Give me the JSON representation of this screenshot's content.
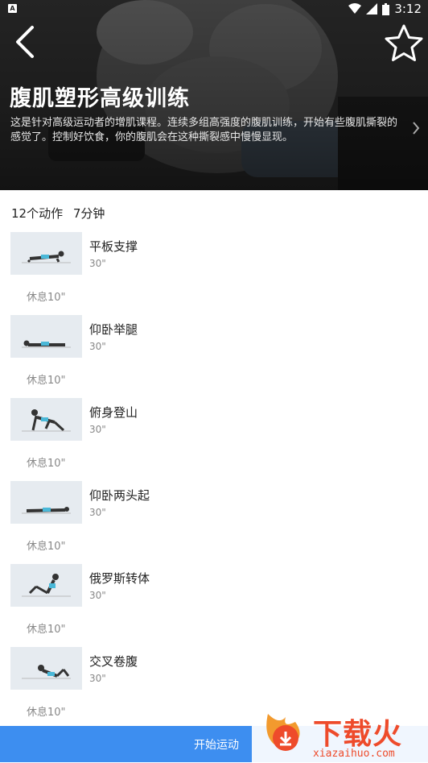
{
  "status_bar": {
    "time": "3:12",
    "notif_glyph": "A"
  },
  "header": {
    "title": "腹肌塑形高级训练",
    "description": "这是针对高级运动者的增肌课程。连续多组高强度的腹肌训练，开始有些腹肌撕裂的感觉了。控制好饮食，你的腹肌会在这种撕裂感中慢慢显现。",
    "icons": {
      "back": "back-arrow-icon",
      "favorite": "star-outline-icon",
      "expand": "chevron-right-icon"
    }
  },
  "summary": {
    "count": "12个动作",
    "duration": "7分钟"
  },
  "exercises": [
    {
      "name": "平板支撑",
      "duration": "30\"",
      "rest": "休息10\""
    },
    {
      "name": "仰卧举腿",
      "duration": "30\"",
      "rest": "休息10\""
    },
    {
      "name": "俯身登山",
      "duration": "30\"",
      "rest": "休息10\""
    },
    {
      "name": "仰卧两头起",
      "duration": "30\"",
      "rest": "休息10\""
    },
    {
      "name": "俄罗斯转体",
      "duration": "30\"",
      "rest": "休息10\""
    },
    {
      "name": "交叉卷腹",
      "duration": "30\"",
      "rest": "休息10\""
    }
  ],
  "start_button": {
    "label": "开始运动"
  },
  "watermark": {
    "text": "下载火",
    "subtext": "xiazaihuo.com"
  },
  "colors": {
    "accent": "#3d8ef0",
    "watermark": "#ee4b2b"
  }
}
